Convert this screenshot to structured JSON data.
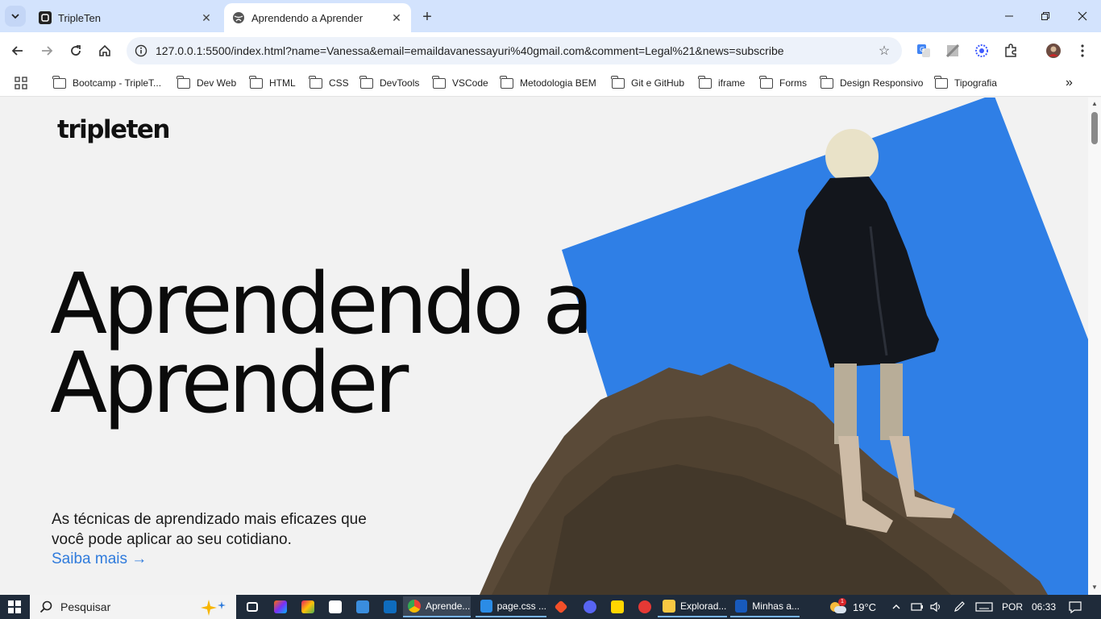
{
  "browser": {
    "tabs": [
      {
        "title": "TripleTen",
        "active": false
      },
      {
        "title": "Aprendendo a Aprender",
        "active": true
      }
    ],
    "url": "127.0.0.1:5500/index.html?name=Vanessa&email=emaildavanessayuri%40gmail.com&comment=Legal%21&news=subscribe",
    "bookmarks": [
      "Bootcamp - TripleT...",
      "Dev Web",
      "HTML",
      "CSS",
      "DevTools",
      "VSCode",
      "Metodologia BEM",
      "Git e GitHub",
      "iframe",
      "Forms",
      "Design Responsivo",
      "Tipografia"
    ],
    "more_bookmarks": "»"
  },
  "page": {
    "logo": "tripleten",
    "title_line1": "Aprendendo a",
    "title_line2": "Aprender",
    "subtitle": "As técnicas de aprendizado mais eficazes que você pode aplicar ao seu cotidiano.",
    "link": "Saiba mais →"
  },
  "colors": {
    "accent_blue": "#2f7bdc",
    "art_blue": "#2f7fe6",
    "page_bg": "#f2f2f2"
  },
  "taskbar": {
    "search_placeholder": "Pesquisar",
    "apps": [
      "Aprende...",
      "page.css ...",
      "Explorad...",
      "Minhas a..."
    ],
    "weather": "19°C",
    "language": "POR",
    "time": "06:33",
    "weather_badge": "1"
  }
}
